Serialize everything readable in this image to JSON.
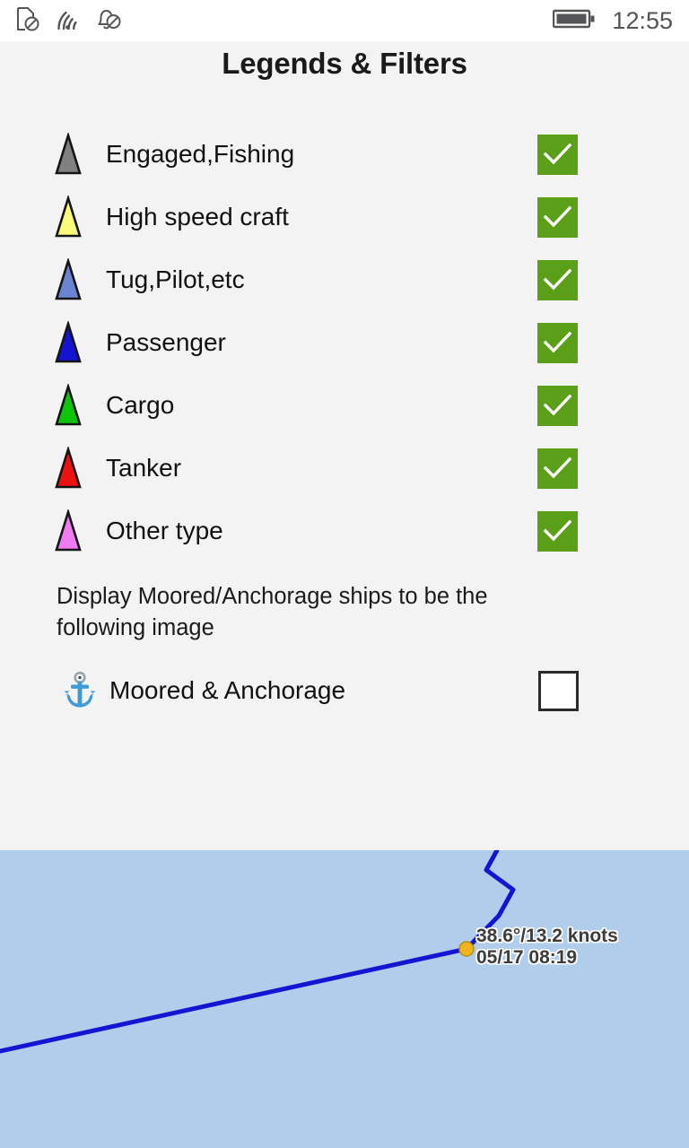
{
  "status_bar": {
    "icons": [
      {
        "name": "sim-card-off-icon",
        "label": "no SIM"
      },
      {
        "name": "wifi-icon",
        "label": "wifi"
      },
      {
        "name": "notification-off-icon",
        "label": "notifications off"
      }
    ],
    "battery": {
      "name": "battery-full-icon",
      "level": "full"
    },
    "time": "12:55"
  },
  "header": {
    "title": "Legends & Filters"
  },
  "legend": {
    "rows": [
      {
        "label": "Engaged,Fishing",
        "color": "#808080",
        "checked": true,
        "marker": "ship-triangle-icon"
      },
      {
        "label": "High speed craft",
        "color": "#fbfb7a",
        "checked": true,
        "marker": "ship-triangle-icon"
      },
      {
        "label": "Tug,Pilot,etc",
        "color": "#6b84d2",
        "checked": true,
        "marker": "ship-triangle-icon"
      },
      {
        "label": "Passenger",
        "color": "#1313d1",
        "checked": true,
        "marker": "ship-triangle-icon"
      },
      {
        "label": "Cargo",
        "color": "#0bc40b",
        "checked": true,
        "marker": "ship-triangle-icon"
      },
      {
        "label": "Tanker",
        "color": "#ee1111",
        "checked": true,
        "marker": "ship-triangle-icon"
      },
      {
        "label": "Other type",
        "color": "#f07af0",
        "checked": true,
        "marker": "ship-triangle-icon"
      }
    ]
  },
  "moored": {
    "note": "Display Moored/Anchorage ships to be the following image",
    "label": "Moored & Anchorage",
    "icon": "anchor-icon",
    "checked": false
  },
  "map": {
    "sea_color": "#b1cdec",
    "track_color": "#1414d2",
    "waypoint_color": "#f0b41e",
    "label_line1": "38.6°/13.2 knots",
    "label_line2": "05/17 08:19"
  },
  "colors": {
    "accent_green": "#5b9e18",
    "page_background": "#f3f3f3",
    "status_background": "#ffffff",
    "text": "#111111"
  }
}
